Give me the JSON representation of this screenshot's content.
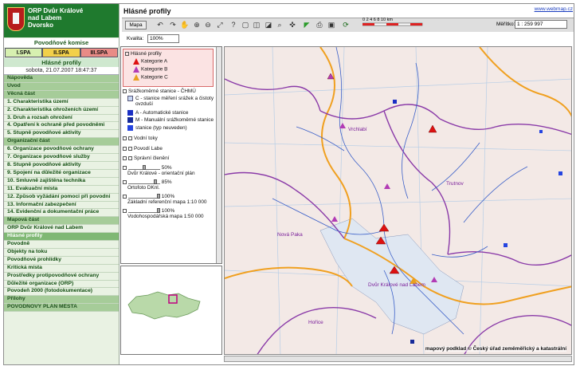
{
  "header": {
    "line1": "ORP Dvůr Králové",
    "line2": "nad Labem",
    "line3": "Dvorsko"
  },
  "komise": "Povodňové komise",
  "spa": [
    "I.SPA",
    "II.SPA",
    "III.SPA"
  ],
  "section_title": "Hlásné profily",
  "datetime": "sobota, 21.07.2007 18:47:37",
  "nav": [
    {
      "label": "Nápověda",
      "kind": "sec"
    },
    {
      "label": "Úvod",
      "kind": "sec"
    },
    {
      "label": "Věcná část",
      "kind": "sec"
    },
    {
      "label": "1. Charakteristika území",
      "kind": "item"
    },
    {
      "label": "2. Charakteristika ohroženích území",
      "kind": "item"
    },
    {
      "label": "3. Druh a rozsah ohrožení",
      "kind": "item"
    },
    {
      "label": "4. Opatření k ochraně před povodněmi",
      "kind": "multi"
    },
    {
      "label": "5. Stupně povodňové aktivity",
      "kind": "item"
    },
    {
      "label": "Organizační část",
      "kind": "sec"
    },
    {
      "label": "6. Organizace povodňové ochrany",
      "kind": "item"
    },
    {
      "label": "7. Organizace povodňové služby",
      "kind": "item"
    },
    {
      "label": "8. Stupně povodňové aktivity",
      "kind": "item"
    },
    {
      "label": "9. Spojení na důležité organizace",
      "kind": "item"
    },
    {
      "label": "10. Smluvně zajištěna technika",
      "kind": "item"
    },
    {
      "label": "11. Evakuační místa",
      "kind": "item"
    },
    {
      "label": "12. Způsob vyžádání pomoci při povodni",
      "kind": "multi"
    },
    {
      "label": "13. Informační zabezpečení",
      "kind": "item"
    },
    {
      "label": "14. Evidenční a dokumentační práce",
      "kind": "item"
    },
    {
      "label": "Mapová část",
      "kind": "sec"
    },
    {
      "label": "ORP Dvůr Králové nad Labem",
      "kind": "item"
    },
    {
      "label": "Hlásné profily",
      "kind": "act"
    },
    {
      "label": "Povodně",
      "kind": "item"
    },
    {
      "label": "Objekty na toku",
      "kind": "item"
    },
    {
      "label": "Povodňové prohlídky",
      "kind": "item"
    },
    {
      "label": "Kritická místa",
      "kind": "item"
    },
    {
      "label": "Prostředky protipovodňové ochrany",
      "kind": "item"
    },
    {
      "label": "Důležité organizace (ORP)",
      "kind": "item"
    },
    {
      "label": "Povodeň 2000 (fotodokumentace)",
      "kind": "item"
    },
    {
      "label": "Přílohy",
      "kind": "sec"
    },
    {
      "label": "POVODŇOVÝ PLÁN MĚSTA",
      "kind": "sec"
    }
  ],
  "toolbar": {
    "title": "Hlásné profily",
    "web_link": "www.webmap.cz",
    "map_button": "Mapa",
    "scale_ticks": "0  2  4  6  8  10 km",
    "meritko_label": "Měřítko:",
    "meritko_value": "1 : 259 997",
    "kvalita_label": "Kvalita:",
    "kvalita_value": "100%"
  },
  "layers": {
    "hlasne": "Hlásné profily",
    "katA": "Kategorie A",
    "katB": "Kategorie B",
    "katC": "Kategorie C",
    "sraz": "Srážkoměrné stanice - ČHMÚ",
    "c_stanice": "C - stanice měření srážek a čistoty ovzduší",
    "a_stanice": "A - Automatické stanice",
    "m_stanice": "M - Manuální srážkoměrné stanice",
    "neuvedeno": "stanice (typ neuveden)",
    "vodni": "Vodní toky",
    "povodi": "Povodí Labe",
    "spravni": "Správní členění",
    "orient_pct": "50%",
    "orient": "Dvůr Králové - orientační plán",
    "orto_pct": "85%",
    "orto": "Ortofoto DKnl.",
    "zakl_pct": "100%",
    "zakl": "Základní referenční mapa 1:10 000",
    "vodoh_pct": "100%",
    "vodoh": "Vodohospodářská mapa 1:50 000"
  },
  "map": {
    "labels": {
      "vrchlabi": "Vrchlabí",
      "trutnov": "Trutnov",
      "nova_paka": "Nová Paka",
      "dvur": "Dvůr Králové nad Labem",
      "horice": "Hořice"
    },
    "copyright": "mapový podklad © Český úřad zeměměřický a katastrální"
  }
}
